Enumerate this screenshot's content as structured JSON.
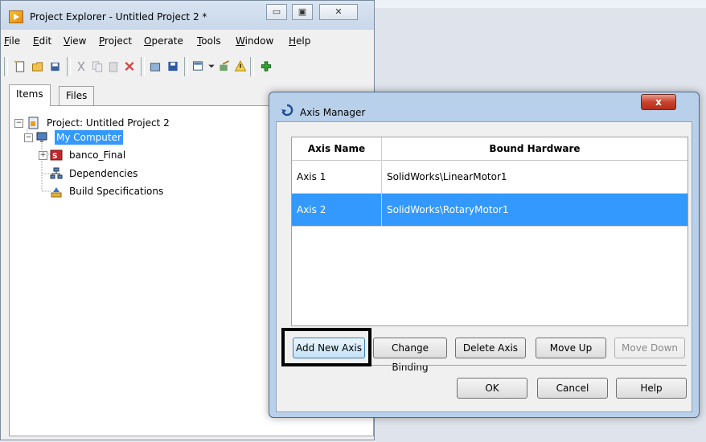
{
  "project_explorer": {
    "title": "Project Explorer - Untitled Project 2 *",
    "caption_buttons": {
      "minimize": "▭",
      "maximize": "▣",
      "close": "✕"
    },
    "menu": [
      "File",
      "Edit",
      "View",
      "Project",
      "Operate",
      "Tools",
      "Window",
      "Help"
    ],
    "menu_mnemonic": [
      "F",
      "E",
      "V",
      "P",
      "O",
      "T",
      "W",
      "H"
    ],
    "tabs": [
      "Items",
      "Files"
    ],
    "tree": {
      "project": "Project: Untitled Project 2",
      "computer": "My Computer",
      "items": [
        "banco_Final",
        "Dependencies",
        "Build Specifications"
      ]
    }
  },
  "axis_manager": {
    "title": "Axis Manager",
    "close_label": "x",
    "columns": [
      "Axis Name",
      "Bound Hardware"
    ],
    "rows": [
      {
        "name": "Axis 1",
        "hardware": "SolidWorks\\LinearMotor1",
        "selected": false
      },
      {
        "name": "Axis 2",
        "hardware": "SolidWorks\\RotaryMotor1",
        "selected": true
      }
    ],
    "buttons": {
      "add": "Add New Axis",
      "change": "Change Binding",
      "delete": "Delete Axis",
      "move_up": "Move Up",
      "move_down": "Move Down",
      "ok": "OK",
      "cancel": "Cancel",
      "help": "Help"
    }
  },
  "colors": {
    "selection": "#3399ff",
    "highlight_box": "#000000"
  }
}
